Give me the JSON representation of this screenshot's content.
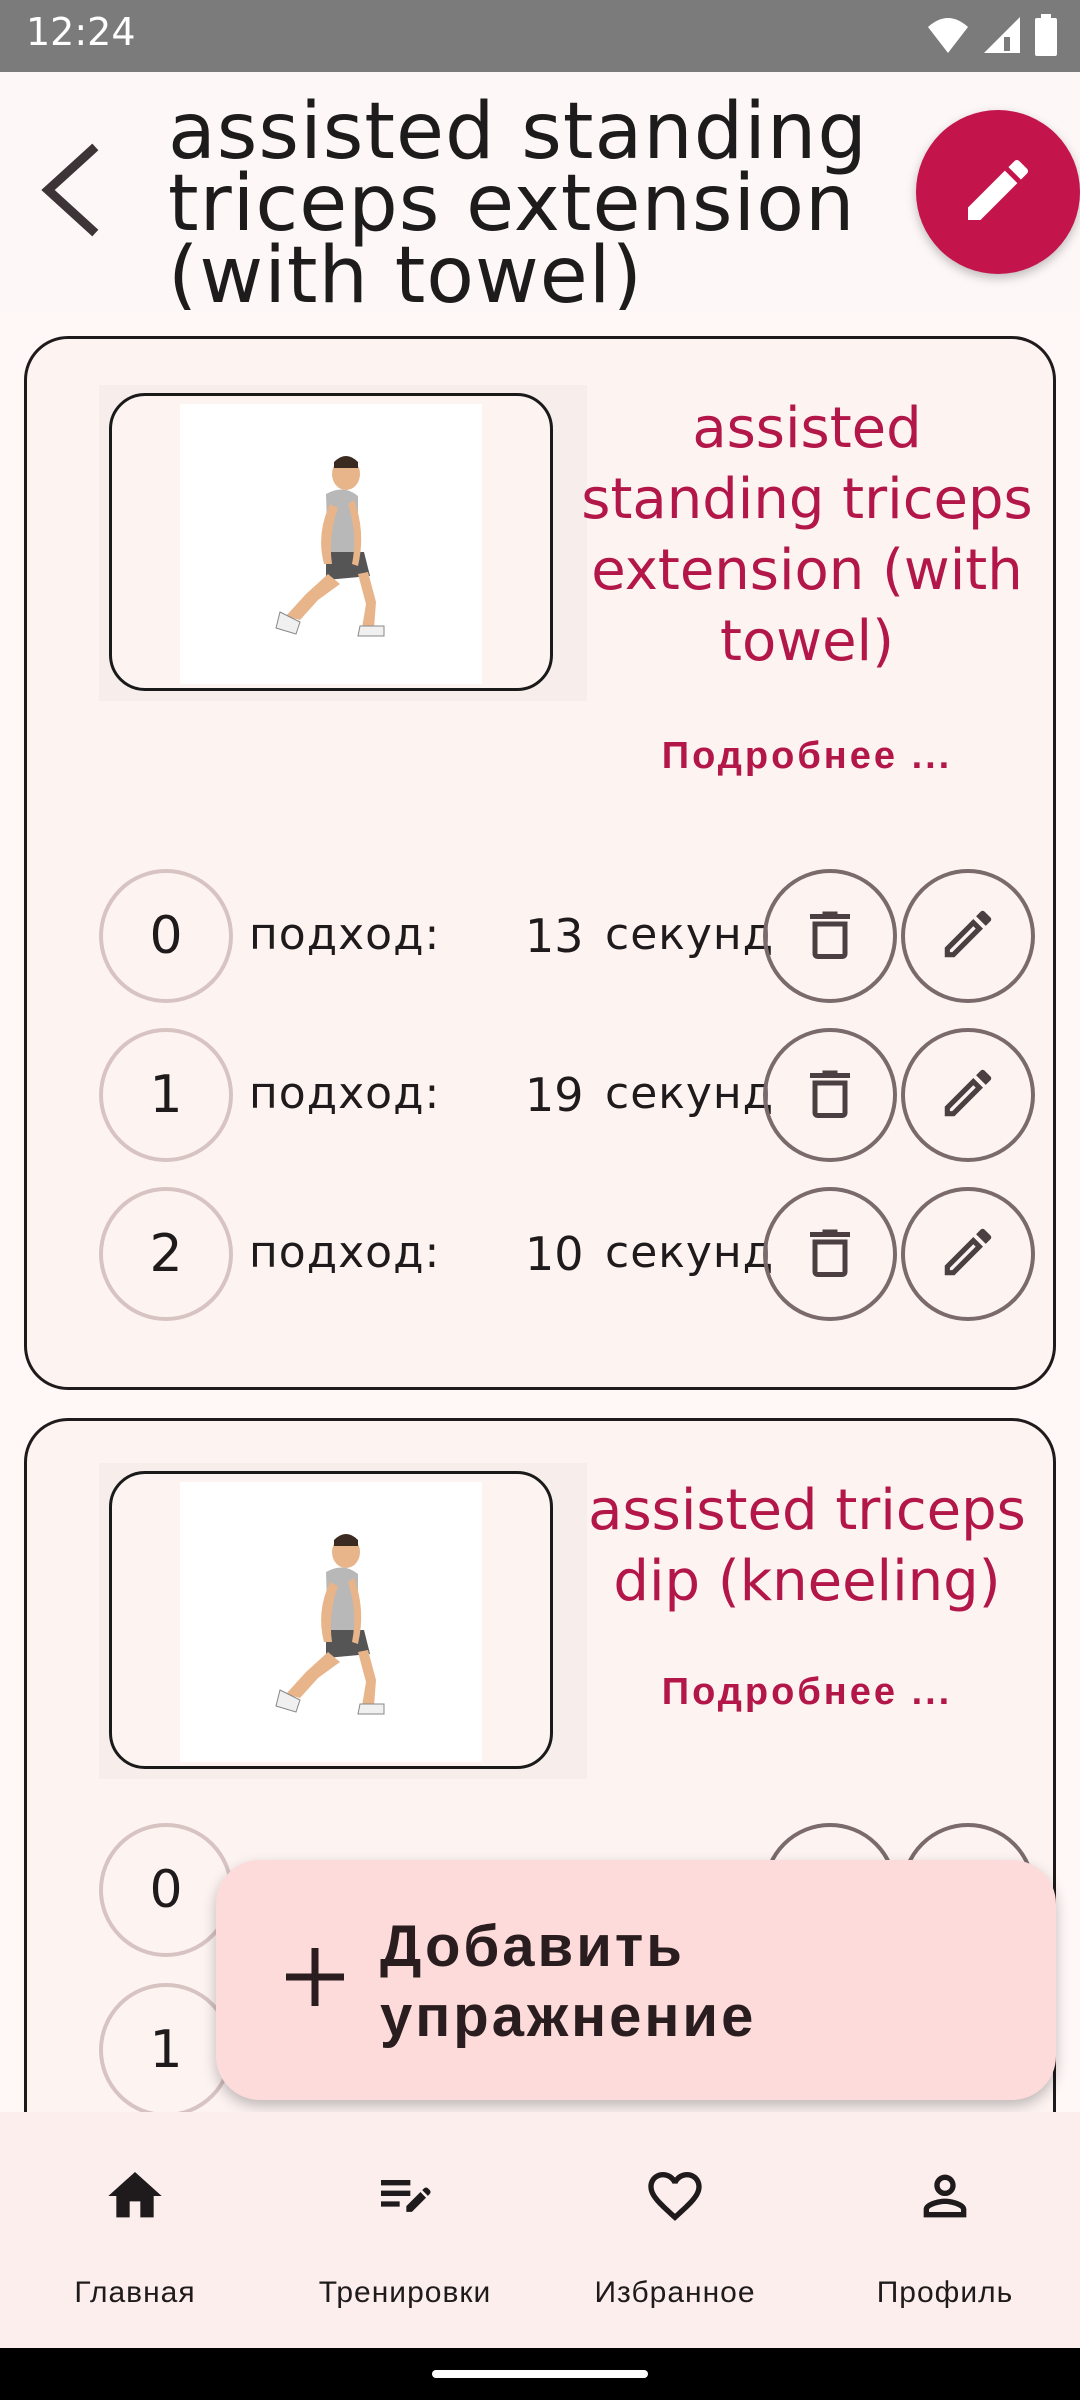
{
  "status_bar": {
    "time": "12:24",
    "icons": [
      "wifi-icon",
      "signal-icon",
      "battery-icon"
    ]
  },
  "header": {
    "title": "assisted standing triceps extension (with towel)",
    "back_icon": "arrow-back-icon",
    "edit_icon": "pencil-icon"
  },
  "exercises": [
    {
      "title": "assisted standing triceps extension (with towel)",
      "details_link": "Подробнее ...",
      "sets": [
        {
          "index": "0",
          "label": "подход:",
          "value": "13",
          "unit": "секунд"
        },
        {
          "index": "1",
          "label": "подход:",
          "value": "19",
          "unit": "секунд"
        },
        {
          "index": "2",
          "label": "подход:",
          "value": "10",
          "unit": "секунд"
        }
      ]
    },
    {
      "title": "assisted triceps dip (kneeling)",
      "details_link": "Подробнее ...",
      "sets": [
        {
          "index": "0"
        },
        {
          "index": "1"
        }
      ]
    }
  ],
  "add_exercise": {
    "label": "Добавить упражнение",
    "icon": "plus-icon"
  },
  "bottom_nav": [
    {
      "label": "Главная",
      "icon": "home-icon"
    },
    {
      "label": "Тренировки",
      "icon": "workouts-list-icon"
    },
    {
      "label": "Избранное",
      "icon": "heart-icon"
    },
    {
      "label": "Профиль",
      "icon": "person-icon"
    }
  ],
  "colors": {
    "accent": "#c4144c",
    "accent_text": "#b3174a",
    "background": "#fff8f7",
    "fab_bg": "#fddbda"
  }
}
